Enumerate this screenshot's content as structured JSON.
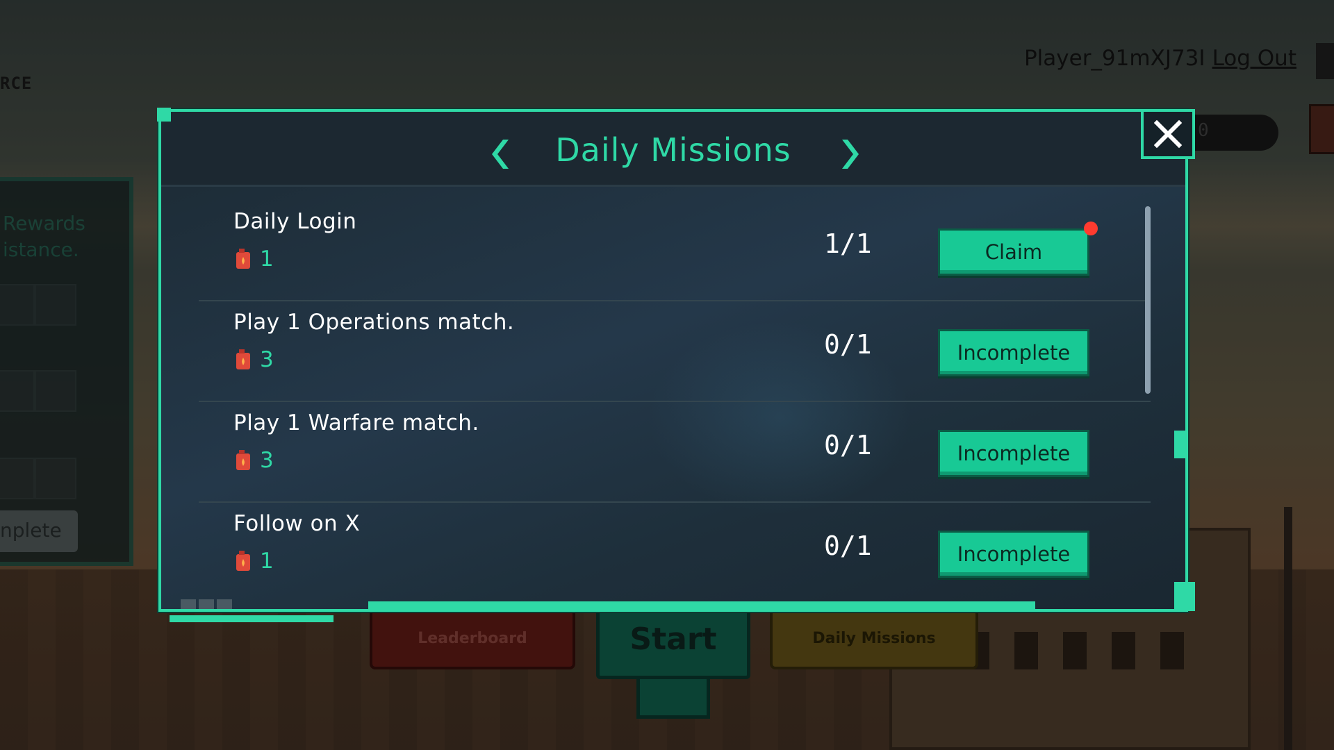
{
  "top_bar": {
    "title_fragment": "RCE",
    "player_name": "Player_91mXJ73I",
    "logout_label": "Log Out",
    "resource_value": "0"
  },
  "side_panel": {
    "text_line1": "Rewards",
    "text_line2": "istance.",
    "button_label": "nplete"
  },
  "bottom_nav": {
    "leaderboard_label": "Leaderboard",
    "start_label": "Start",
    "daily_missions_label": "Daily Missions"
  },
  "modal": {
    "title": "Daily Missions",
    "missions": [
      {
        "name": "Daily Login",
        "reward": "1",
        "progress": "1/1",
        "button": "Claim",
        "has_notification": true
      },
      {
        "name": "Play 1 Operations match.",
        "reward": "3",
        "progress": "0/1",
        "button": "Incomplete",
        "has_notification": false
      },
      {
        "name": "Play 1 Warfare match.",
        "reward": "3",
        "progress": "0/1",
        "button": "Incomplete",
        "has_notification": false
      },
      {
        "name": "Follow on X",
        "reward": "1",
        "progress": "0/1",
        "button": "Incomplete",
        "has_notification": false
      }
    ]
  },
  "colors": {
    "accent": "#2fd9a6",
    "button": "#18c995",
    "notification": "#ff3b2f",
    "reward_icon": "#e04a3a"
  },
  "icons": {
    "reward": "fuel-can-icon",
    "close": "close-icon",
    "prev": "chevron-left-icon",
    "next": "chevron-right-icon"
  }
}
